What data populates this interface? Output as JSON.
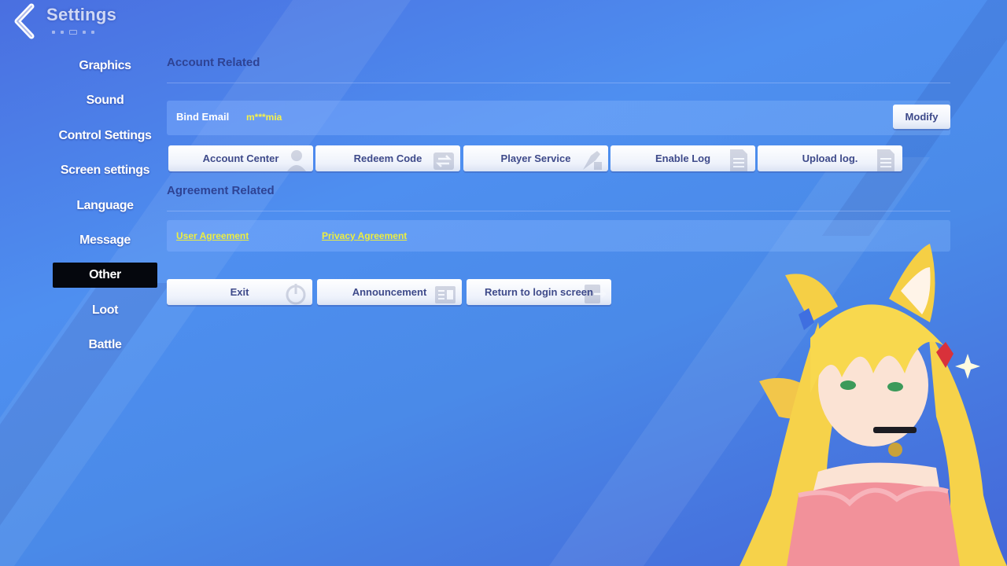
{
  "header": {
    "title": "Settings",
    "back_icon": "chevron-left-icon"
  },
  "sidebar": {
    "items": [
      {
        "label": "Graphics",
        "active": false
      },
      {
        "label": "Sound",
        "active": false
      },
      {
        "label": "Control Settings",
        "active": false
      },
      {
        "label": "Screen settings",
        "active": false
      },
      {
        "label": "Language",
        "active": false
      },
      {
        "label": "Message",
        "active": false
      },
      {
        "label": "Other",
        "active": true
      },
      {
        "label": "Loot",
        "active": false
      },
      {
        "label": "Battle",
        "active": false
      }
    ]
  },
  "account": {
    "title": "Account Related",
    "bind_email_label": "Bind Email",
    "bind_email_value": "m***mia",
    "modify_label": "Modify",
    "buttons": [
      {
        "label": "Account Center",
        "icon": "profile-icon"
      },
      {
        "label": "Redeem Code",
        "icon": "exchange-icon"
      },
      {
        "label": "Player Service",
        "icon": "support-icon"
      },
      {
        "label": "Enable Log",
        "icon": "document-icon"
      },
      {
        "label": "Upload log.",
        "icon": "document-icon"
      }
    ]
  },
  "agreement": {
    "title": "Agreement Related",
    "user_agreement": "User Agreement",
    "privacy_agreement": "Privacy Agreement"
  },
  "actions": [
    {
      "label": "Exit",
      "icon": "power-icon"
    },
    {
      "label": "Announcement",
      "icon": "announcement-icon"
    },
    {
      "label": "Return to login screen",
      "icon": "logout-icon"
    }
  ],
  "colors": {
    "background": "#4e8ff0",
    "link": "#ecee40",
    "email_value": "#f6f24a",
    "button_text": "#3e4a8a",
    "section_title": "#2e4394",
    "active_nav": "#05070d"
  }
}
